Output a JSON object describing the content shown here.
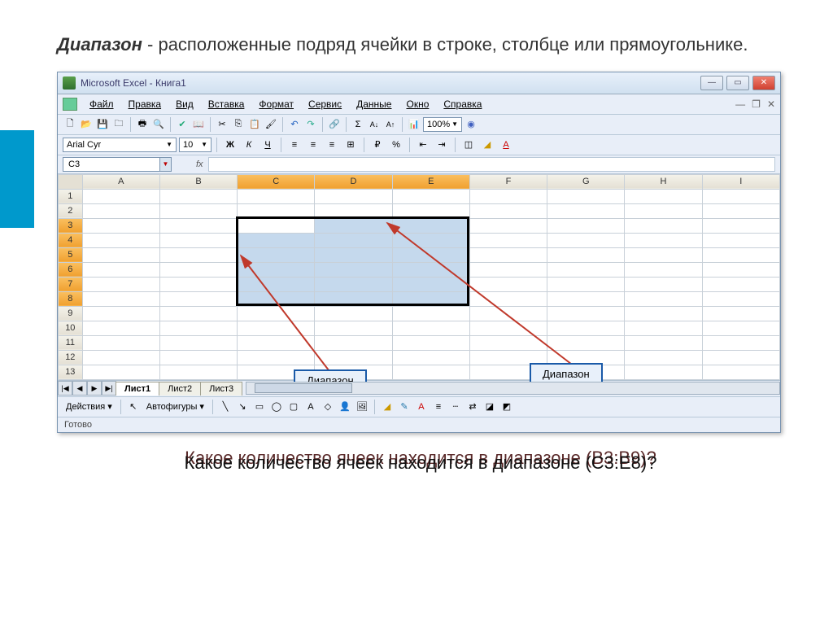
{
  "definition": {
    "term": "Диапазон",
    "text": " - расположенные подряд ячейки в строке, столбце или прямоугольнике."
  },
  "window": {
    "title": "Microsoft Excel - Книга1"
  },
  "menu": {
    "file": "Файл",
    "edit": "Правка",
    "view": "Вид",
    "insert": "Вставка",
    "format": "Формат",
    "tools": "Сервис",
    "data": "Данные",
    "window": "Окно",
    "help": "Справка"
  },
  "toolbar": {
    "zoom": "100%"
  },
  "format_bar": {
    "font": "Arial Cyr",
    "size": "10",
    "bold": "Ж",
    "italic": "К",
    "under": "Ч"
  },
  "namebox": {
    "ref": "C3",
    "fx": "fx"
  },
  "columns": [
    "A",
    "B",
    "C",
    "D",
    "E",
    "F",
    "G",
    "H",
    "I"
  ],
  "rows": [
    "1",
    "2",
    "3",
    "4",
    "5",
    "6",
    "7",
    "8",
    "9",
    "10",
    "11",
    "12",
    "13"
  ],
  "selected_cols": [
    "C",
    "D",
    "E"
  ],
  "selected_rows": [
    "3",
    "4",
    "5",
    "6",
    "7",
    "8"
  ],
  "active_cell": "C3",
  "callouts": {
    "left": "Диапазон",
    "right": "Диапазон"
  },
  "tabs": {
    "t1": "Лист1",
    "t2": "Лист2",
    "t3": "Лист3"
  },
  "draw_bar": {
    "actions": "Действия",
    "autoshapes": "Автофигуры"
  },
  "status": "Готово",
  "questions": {
    "q1": "Какое количество ячеек находится в диапазоне (B3:B9)?",
    "q2": "Какое количество ячеек находится в диапазоне (C3:E8)?"
  }
}
